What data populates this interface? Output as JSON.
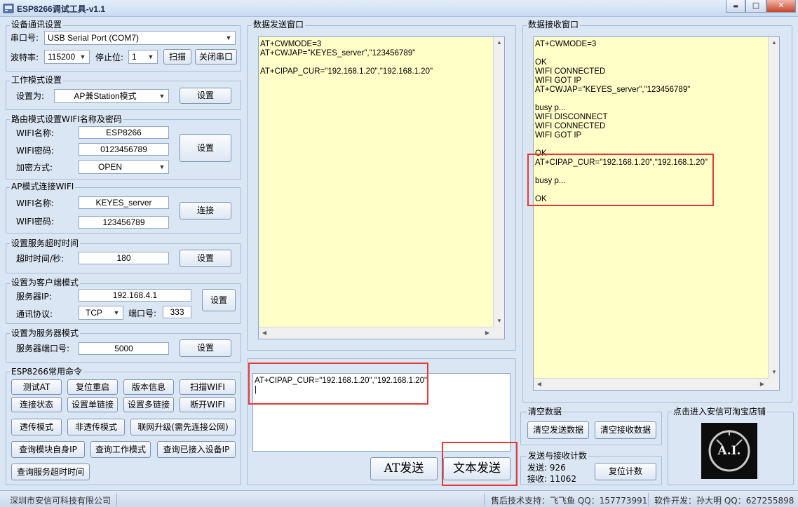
{
  "window": {
    "title": "ESP8266调试工具-v1.1",
    "min": "▬",
    "max": "□",
    "close": "✕"
  },
  "serial": {
    "group": "设备通讯设置",
    "port_label": "串口号:",
    "port_value": "USB Serial Port (COM7)",
    "baud_label": "波特率:",
    "baud_value": "115200",
    "stop_label": "停止位:",
    "stop_value": "1",
    "scan_button": "扫描",
    "close_button": "关闭串口"
  },
  "work_mode": {
    "group": "工作模式设置",
    "label": "设置为:",
    "value": "AP兼Station模式",
    "set_button": "设置"
  },
  "router_wifi": {
    "group": "路由模式设置WIFI名称及密码",
    "name_label": "WIFI名称:",
    "name_value": "ESP8266",
    "pwd_label": "WIFI密码:",
    "pwd_value": "0123456789",
    "enc_label": "加密方式:",
    "enc_value": "OPEN",
    "set_button": "设置"
  },
  "ap_connect": {
    "group": "AP模式连接WIFI",
    "name_label": "WIFI名称:",
    "name_value": "KEYES_server",
    "pwd_label": "WIFI密码:",
    "pwd_value": "123456789",
    "connect_button": "连接"
  },
  "timeout": {
    "group": "设置服务超时时间",
    "label": "超时时间/秒:",
    "value": "180",
    "set_button": "设置"
  },
  "client": {
    "group": "设置为客户端模式",
    "ip_label": "服务器IP:",
    "ip_value": "192.168.4.1",
    "proto_label": "通讯协议:",
    "proto_value": "TCP",
    "port_label": "端口号:",
    "port_value": "333",
    "set_button": "设置"
  },
  "server": {
    "group": "设置为服务器模式",
    "port_label": "服务器端口号:",
    "port_value": "5000",
    "set_button": "设置"
  },
  "commands": {
    "group": "ESP8266常用命令",
    "test_at": "测试AT",
    "reset": "复位重启",
    "version": "版本信息",
    "scan_wifi": "扫描WIFI",
    "conn_status": "连接状态",
    "single_link": "设置单链接",
    "multi_link": "设置多链接",
    "disconnect_wifi": "断开WIFI",
    "transparent": "透传模式",
    "non_transparent": "非透传模式",
    "online_upgrade": "联网升级(需先连接公网)",
    "query_ip": "查询模块自身IP",
    "query_mode": "查询工作模式",
    "query_devices": "查询已接入设备IP",
    "query_timeout": "查询服务超时时间"
  },
  "send_window": {
    "group": "数据发送窗口",
    "lines": [
      "AT+CWMODE=3",
      "AT+CWJAP=\"KEYES_server\",\"123456789\"",
      "",
      "AT+CIPAP_CUR=\"192.168.1.20\",\"192.168.1.20\""
    ],
    "input_lines": [
      "AT+CIPAP_CUR=\"192.168.1.20\",\"192.168.1.20\"",
      "|"
    ],
    "at_send_button": "AT发送",
    "text_send_button": "文本发送"
  },
  "receive_window": {
    "group": "数据接收窗口",
    "lines": [
      "AT+CWMODE=3",
      "",
      "OK",
      "WIFI CONNECTED",
      "WIFI GOT IP",
      "AT+CWJAP=\"KEYES_server\",\"123456789\"",
      "",
      "busy p...",
      "WIFI DISCONNECT",
      "WIFI CONNECTED",
      "WIFI GOT IP",
      "",
      "OK",
      "AT+CIPAP_CUR=\"192.168.1.20\",\"192.168.1.20\"",
      "",
      "busy p...",
      "",
      "OK"
    ]
  },
  "clear": {
    "group": "清空数据",
    "clear_send": "清空发送数据",
    "clear_recv": "清空接收数据"
  },
  "counter": {
    "group": "发送与接收计数",
    "sent_label": "发送:",
    "sent_value": "926",
    "recv_label": "接收:",
    "recv_value": "11062",
    "reset_button": "复位计数"
  },
  "shop": {
    "group": "点击进入安信可淘宝店铺",
    "logo_text": "A.I."
  },
  "status": {
    "company": "深圳市安信可科技有限公司",
    "support": "售后技术支持：飞飞鱼 QQ：157773991",
    "developer": "软件开发：孙大明 QQ：627255898"
  }
}
